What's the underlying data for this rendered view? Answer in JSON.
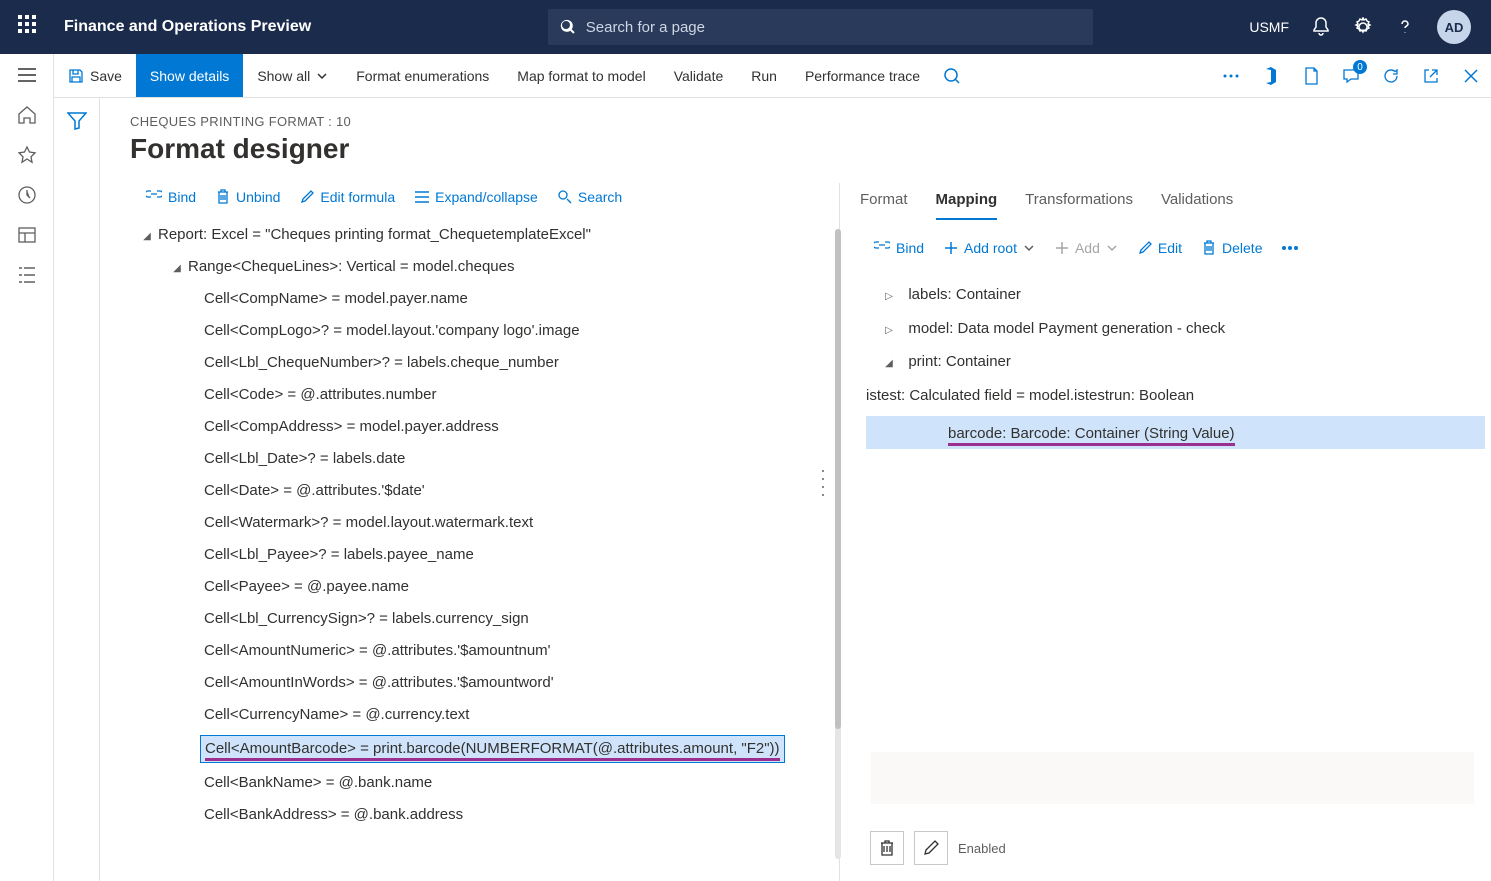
{
  "header": {
    "app_title": "Finance and Operations Preview",
    "search_placeholder": "Search for a page",
    "company": "USMF",
    "avatar": "AD",
    "badge_count": "0"
  },
  "commands": {
    "save": "Save",
    "show_details": "Show details",
    "show_all": "Show all",
    "format_enum": "Format enumerations",
    "map_format": "Map format to model",
    "validate": "Validate",
    "run": "Run",
    "perf": "Performance trace"
  },
  "page": {
    "breadcrumb": "CHEQUES PRINTING FORMAT : 10",
    "title": "Format designer"
  },
  "left_toolbar": {
    "bind": "Bind",
    "unbind": "Unbind",
    "edit_formula": "Edit formula",
    "expand": "Expand/collapse",
    "search": "Search"
  },
  "format_tree": {
    "root": "Report: Excel = \"Cheques printing format_ChequetemplateExcel\"",
    "range": "Range<ChequeLines>: Vertical = model.cheques",
    "cells": [
      "Cell<CompName> = model.payer.name",
      "Cell<CompLogo>? = model.layout.'company logo'.image",
      "Cell<Lbl_ChequeNumber>? = labels.cheque_number",
      "Cell<Code> = @.attributes.number",
      "Cell<CompAddress> = model.payer.address",
      "Cell<Lbl_Date>? = labels.date",
      "Cell<Date> = @.attributes.'$date'",
      "Cell<Watermark>? = model.layout.watermark.text",
      "Cell<Lbl_Payee>? = labels.payee_name",
      "Cell<Payee> = @.payee.name",
      "Cell<Lbl_CurrencySign>? = labels.currency_sign",
      "Cell<AmountNumeric> = @.attributes.'$amountnum'",
      "Cell<AmountInWords> = @.attributes.'$amountword'",
      "Cell<CurrencyName> = @.currency.text"
    ],
    "selected": "Cell<AmountBarcode> = print.barcode(NUMBERFORMAT(@.attributes.amount, \"F2\"))",
    "after": [
      "Cell<BankName> = @.bank.name",
      "Cell<BankAddress> = @.bank.address"
    ]
  },
  "tabs": {
    "format": "Format",
    "mapping": "Mapping",
    "transformations": "Transformations",
    "validations": "Validations"
  },
  "map_toolbar": {
    "bind": "Bind",
    "add_root": "Add root",
    "add": "Add",
    "edit": "Edit",
    "delete": "Delete"
  },
  "map_tree": {
    "labels": "labels: Container",
    "model": "model: Data model Payment generation - check",
    "print": "print: Container",
    "istest": "istest: Calculated field = model.istestrun: Boolean",
    "barcode": "barcode: Barcode: Container (String Value)"
  },
  "bottom": {
    "enabled": "Enabled"
  }
}
